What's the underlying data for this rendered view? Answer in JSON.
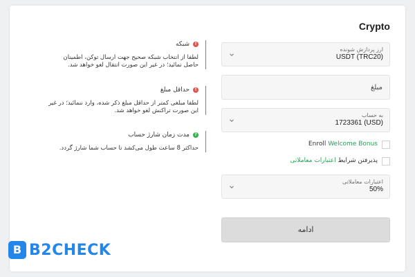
{
  "page": {
    "title": "Crypto"
  },
  "form": {
    "gateway": {
      "label": "ارز پردازش شونده",
      "value": "USDT (TRC20)"
    },
    "amount": {
      "placeholder": "مبلغ"
    },
    "account": {
      "label": "به حساب",
      "value": "1723361 (USD)"
    },
    "bonus": {
      "prefix": "Enroll ",
      "link": "Welcome Bonus"
    },
    "terms": {
      "text": "پذیرفتن شرایط ",
      "link": "اعتبارات معاملاتی"
    },
    "credit": {
      "label": "اعتبارات معاملاتی",
      "value": "50%"
    },
    "submit_label": "ادامه"
  },
  "notes": [
    {
      "title": "شبکه",
      "body": "لطفا از انتخاب شبکه صحیح جهت ارسال توکن، اطمینان حاصل نمائید؛ در غیر این صورت انتقال لغو خواهد شد.",
      "status": "error"
    },
    {
      "title": "حداقل مبلغ",
      "body": "لطفا مبلغی کمتر از حداقل مبلغ ذکر شده، وارد ننمائید؛ در غیر این صورت تراکنش لغو خواهد شد.",
      "status": "error"
    },
    {
      "title": "مدت زمان شارژ حساب",
      "body": "حداکثر 8 ساعت طول می‌کشد تا حساب شما شارژ گردد.",
      "status": "info"
    }
  ],
  "icons": {
    "error": "!",
    "info": "?"
  },
  "brand": {
    "mark": "B",
    "word": "B2CHECK",
    "color": "#2386e8"
  },
  "colors": {
    "accent_green": "#23a455",
    "error_red": "#e0554f",
    "ok_green": "#35b14f"
  }
}
